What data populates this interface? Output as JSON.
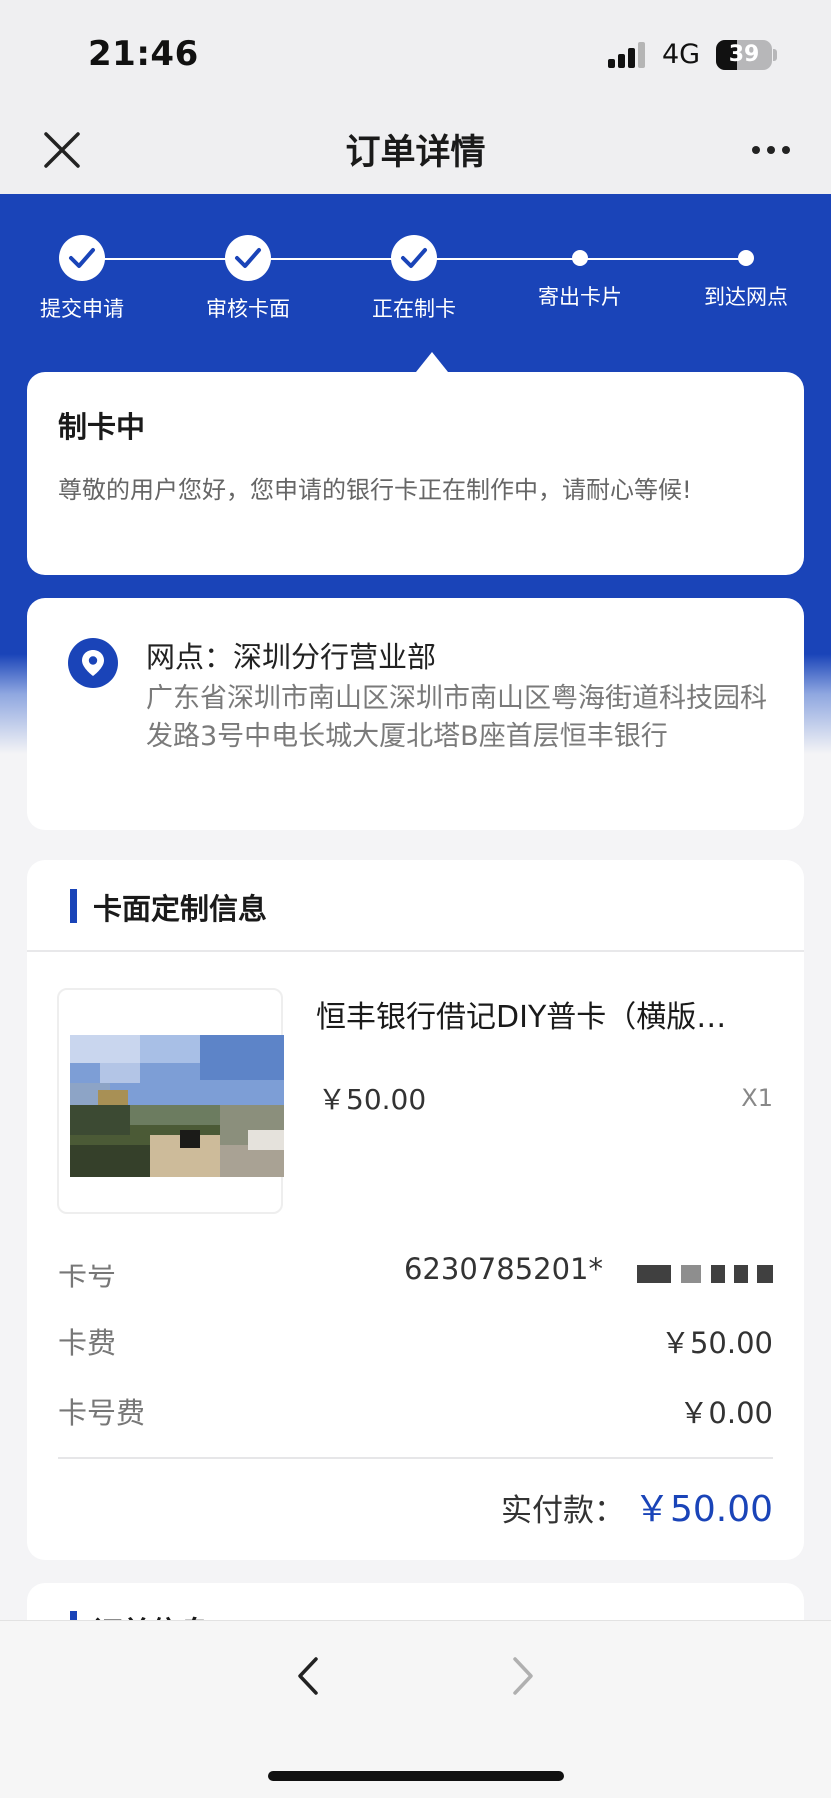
{
  "status_bar": {
    "time": "21:46",
    "network": "4G",
    "battery": "39"
  },
  "nav": {
    "title": "订单详情"
  },
  "progress": {
    "steps": [
      {
        "label": "提交申请",
        "done": true
      },
      {
        "label": "审核卡面",
        "done": true
      },
      {
        "label": "正在制卡",
        "done": true
      },
      {
        "label": "寄出卡片",
        "done": false
      },
      {
        "label": "到达网点",
        "done": false
      }
    ],
    "current_step": 3
  },
  "status": {
    "title": "制卡中",
    "description": "尊敬的用户您好，您申请的银行卡正在制作中，请耐心等候!"
  },
  "branch": {
    "name": "网点：深圳分行营业部",
    "address": "广东省深圳市南山区深圳市南山区粤海街道科技园科发路3号中电长城大厦北塔B座首层恒丰银行"
  },
  "card_info": {
    "section_title": "卡面定制信息",
    "product_name": "恒丰银行借记DIY普卡（横版…",
    "price": "￥50.00",
    "quantity": "X1",
    "rows": {
      "card_no_label": "卡号",
      "card_no_value": "6230785201*",
      "fee_label": "卡费",
      "fee_value": "￥50.00",
      "number_fee_label": "卡号费",
      "number_fee_value": "￥0.00"
    },
    "total_label": "实付款：",
    "total_value": "￥50.00"
  },
  "order_info": {
    "section_title": "订单信息"
  },
  "colors": {
    "brand_blue": "#1a44b8",
    "background": "#f4f4f6"
  },
  "icons": {
    "close": "close-icon",
    "more": "more-icon",
    "location": "location-pin-icon",
    "back": "chevron-left-icon",
    "forward": "chevron-right-icon"
  }
}
